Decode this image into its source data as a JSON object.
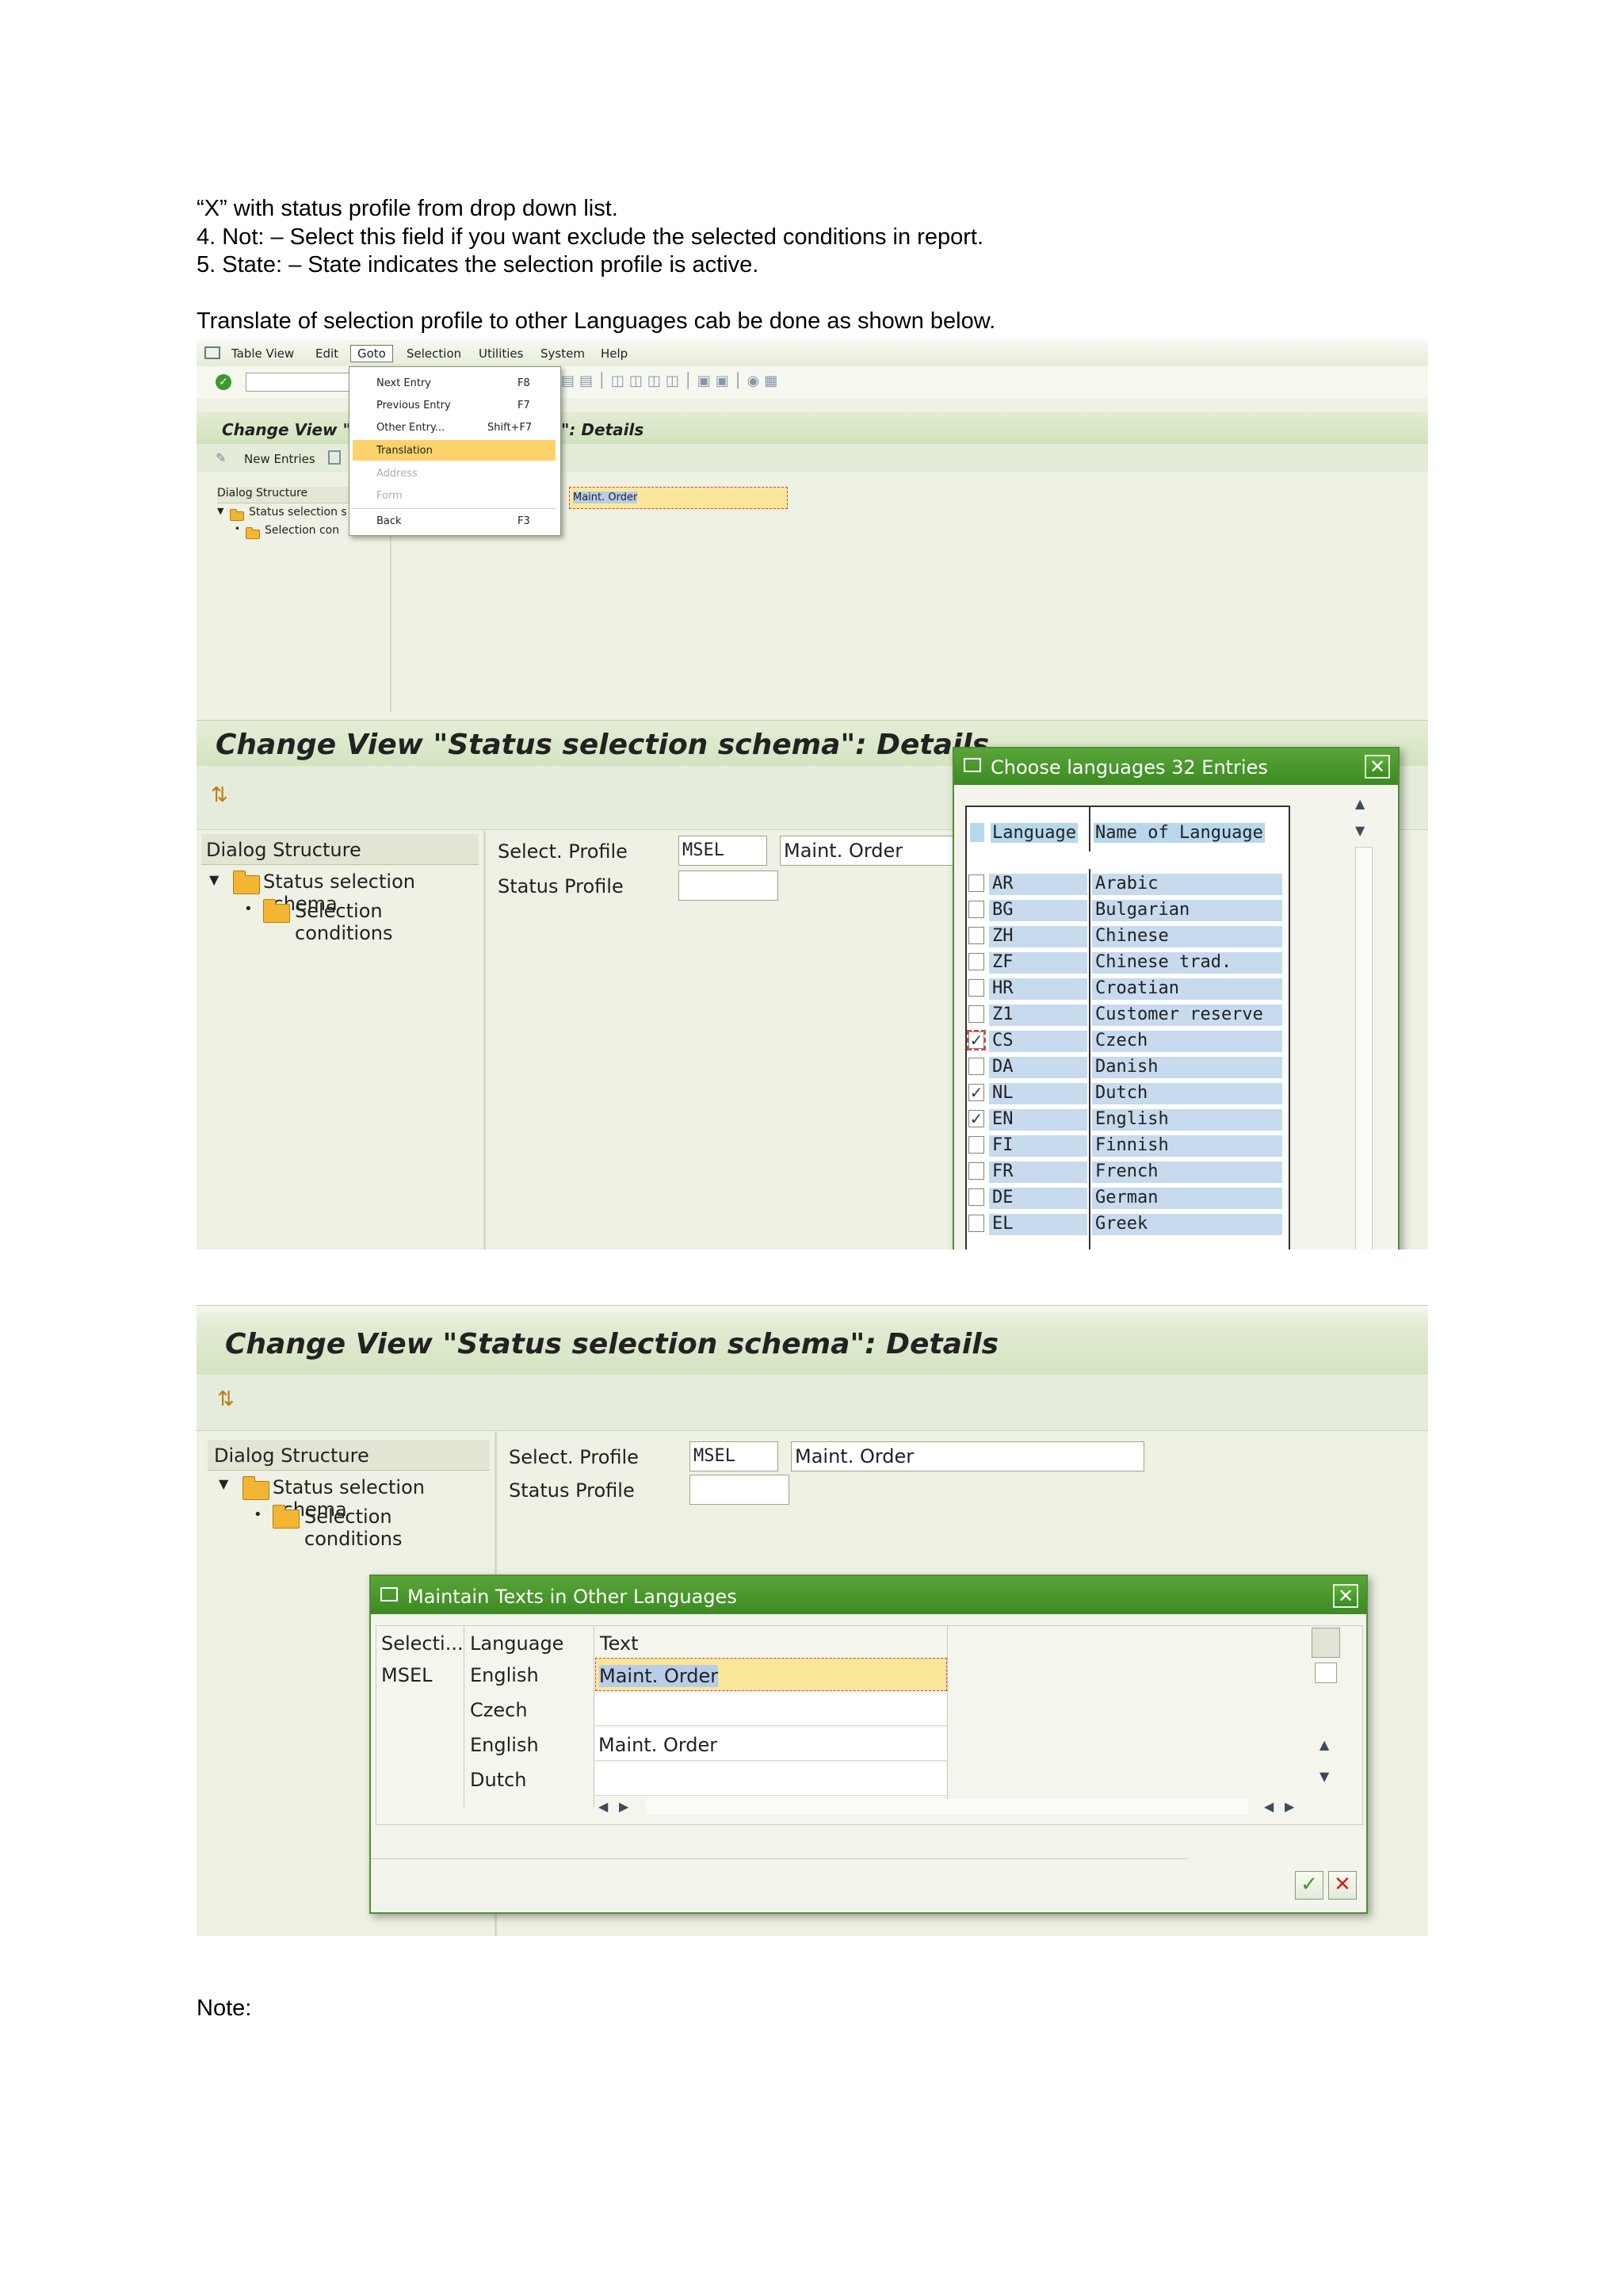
{
  "doc": {
    "line1": "“X” with status profile from drop down list.",
    "line2": "4. Not: – Select this field if you want exclude the selected conditions in report.",
    "line3": "5. State: – State indicates the selection profile is active.",
    "line4": "Translate of selection profile to other Languages cab be done as shown below.",
    "note": "Note:"
  },
  "shot1": {
    "menubar": [
      "Table View",
      "Edit",
      "Goto",
      "Selection",
      "Utilities",
      "System",
      "Help"
    ],
    "title_left": "Change View \"",
    "title_right": "\": Details",
    "new_entries": "New Entries",
    "dialog_structure": "Dialog Structure",
    "tree_item1": "Status selection s",
    "tree_item2": "Selection con",
    "field_value": "Maint. Order",
    "goto_menu": [
      {
        "label": "Next Entry",
        "shortcut": "F8"
      },
      {
        "label": "Previous Entry",
        "shortcut": "F7"
      },
      {
        "label": "Other Entry...",
        "shortcut": "Shift+F7"
      },
      {
        "label": "Translation",
        "shortcut": ""
      },
      {
        "label": "Address",
        "shortcut": ""
      },
      {
        "label": "Form",
        "shortcut": ""
      },
      {
        "label": "Back",
        "shortcut": "F3"
      }
    ]
  },
  "shot2": {
    "title": "Change View \"Status selection schema\": Details",
    "dialog_structure": "Dialog Structure",
    "tree_item1": "Status selection schema",
    "tree_item2": "Selection conditions",
    "select_profile_label": "Select. Profile",
    "select_profile_value": "MSEL",
    "select_profile_text": "Maint. Order",
    "status_profile_label": "Status Profile",
    "popup_title": "Choose languages 32 Entries",
    "col_language": "Language",
    "col_name": "Name of Language",
    "rows": [
      {
        "code": "AR",
        "name": "Arabic",
        "checked": false
      },
      {
        "code": "BG",
        "name": "Bulgarian",
        "checked": false
      },
      {
        "code": "ZH",
        "name": "Chinese",
        "checked": false
      },
      {
        "code": "ZF",
        "name": "Chinese trad.",
        "checked": false
      },
      {
        "code": "HR",
        "name": "Croatian",
        "checked": false
      },
      {
        "code": "Z1",
        "name": "Customer reserve",
        "checked": false
      },
      {
        "code": "CS",
        "name": "Czech",
        "checked": true
      },
      {
        "code": "DA",
        "name": "Danish",
        "checked": false
      },
      {
        "code": "NL",
        "name": "Dutch",
        "checked": true
      },
      {
        "code": "EN",
        "name": "English",
        "checked": true
      },
      {
        "code": "FI",
        "name": "Finnish",
        "checked": false
      },
      {
        "code": "FR",
        "name": "French",
        "checked": false
      },
      {
        "code": "DE",
        "name": "German",
        "checked": false
      },
      {
        "code": "EL",
        "name": "Greek",
        "checked": false
      }
    ]
  },
  "shot3": {
    "title": "Change View \"Status selection schema\": Details",
    "dialog_structure": "Dialog Structure",
    "tree_item1": "Status selection schema",
    "tree_item2": "Selection conditions",
    "select_profile_label": "Select. Profile",
    "select_profile_value": "MSEL",
    "select_profile_text": "Maint. Order",
    "status_profile_label": "Status Profile",
    "popup_title": "Maintain Texts in Other Languages",
    "col_selecti": "Selecti...",
    "col_language": "Language",
    "col_text": "Text",
    "rows": [
      {
        "sel": "MSEL",
        "lang": "English",
        "text": "Maint. Order"
      },
      {
        "sel": "",
        "lang": "Czech",
        "text": ""
      },
      {
        "sel": "",
        "lang": "English",
        "text": "Maint. Order"
      },
      {
        "sel": "",
        "lang": "Dutch",
        "text": ""
      }
    ]
  },
  "colors": {
    "sap_green": "#3b8a22",
    "highlight": "#fbe79a",
    "selection_blue": "#b7cde8"
  }
}
